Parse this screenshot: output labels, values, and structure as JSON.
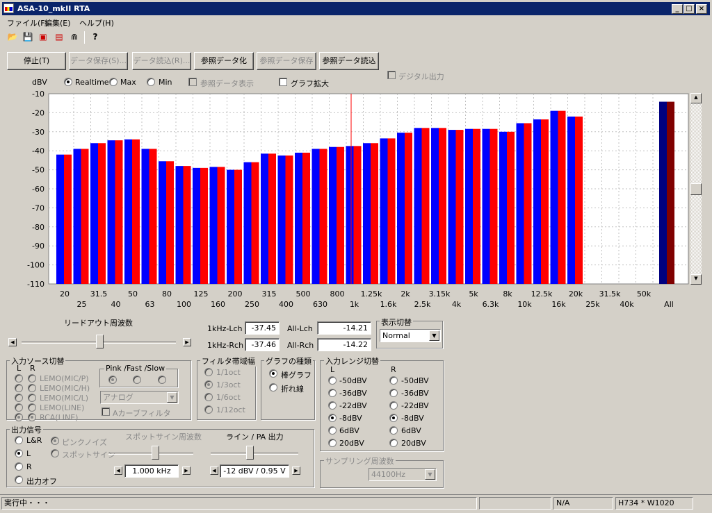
{
  "window": {
    "title": "ASA-10_mkII RTA",
    "min": "_",
    "max": "□",
    "close": "×"
  },
  "menu": [
    "ファイル(F)",
    "編集(E)",
    "ヘルプ(H)"
  ],
  "toolbar_icons": [
    "open-icon",
    "save-icon",
    "save-as-icon",
    "export-icon",
    "connect-icon",
    "help-icon"
  ],
  "buttons": {
    "stop": "停止(T)",
    "save_data": "データ保存(S)...",
    "load_data": "データ読込(R)...",
    "ref_set": "参照データ化",
    "ref_save": "参照データ保存",
    "ref_load": "参照データ読込"
  },
  "display": {
    "unit": "dBV",
    "realtime": "Realtime",
    "max": "Max",
    "min": "Min",
    "ref_show": "参照データ表示",
    "zoom": "グラフ拡大",
    "digital_out": "デジタル出力"
  },
  "chart_data": {
    "type": "bar",
    "ylim": [
      -110,
      -10
    ],
    "yticks": [
      "-10",
      "-20",
      "-30",
      "-40",
      "-50",
      "-60",
      "-70",
      "-80",
      "-90",
      "-100",
      "-110"
    ],
    "categories": [
      "20",
      "25",
      "31.5",
      "40",
      "50",
      "63",
      "80",
      "100",
      "125",
      "160",
      "200",
      "250",
      "315",
      "400",
      "500",
      "630",
      "800",
      "1k",
      "1.25k",
      "1.6k",
      "2k",
      "2.5k",
      "3.15k",
      "4k",
      "5k",
      "6.3k",
      "8k",
      "10k",
      "12.5k",
      "16k",
      "20k",
      "25k",
      "31.5k",
      "40k",
      "50k",
      "All"
    ],
    "series": [
      {
        "values": [
          -42,
          -39,
          -36,
          -34.5,
          -34,
          -39,
          -45.5,
          -48,
          -49,
          -48.5,
          -50,
          -46,
          -41.5,
          -42.5,
          -41,
          -39,
          -38,
          -37.5,
          -36,
          -33.5,
          -30.5,
          -28,
          -28,
          -29,
          -28.5,
          -28.5,
          -30,
          -25.5,
          -23.5,
          -19,
          -22,
          null,
          null,
          null,
          null,
          -14.21
        ],
        "color": "#0000ff",
        "all_color": "#000080"
      },
      {
        "values": [
          -42,
          -39,
          -36,
          -34.5,
          -34,
          -39,
          -45.5,
          -48,
          -49,
          -48.5,
          -50,
          -46,
          -41.5,
          -42.5,
          -41,
          -39,
          -38,
          -37.5,
          -36,
          -33.5,
          -30.5,
          -28,
          -28,
          -29,
          -28.5,
          -28.5,
          -30,
          -25.5,
          -23.5,
          -19,
          -22,
          null,
          null,
          null,
          null,
          -14.22
        ],
        "color": "#ff0000",
        "all_color": "#800000"
      }
    ]
  },
  "readout": {
    "lch_label": "1kHz-Lch",
    "lch": "-37.45",
    "rch_label": "1kHz-Rch",
    "rch": "-37.46",
    "all_l_label": "All-Lch",
    "all_l": "-14.21",
    "all_r_label": "All-Rch",
    "all_r": "-14.22"
  },
  "readout_freq": {
    "label": "リードアウト周波数"
  },
  "view_switch": {
    "title": "表示切替",
    "value": "Normal"
  },
  "input_source": {
    "title": "入力ソース切替",
    "l": "L",
    "r": "R",
    "items": [
      "LEMO(MIC/P)",
      "LEMO(MIC/H)",
      "LEMO(MIC/L)",
      "LEMO(LINE)",
      "RCA(LINE)"
    ],
    "pink_title": "Pink /Fast /Slow",
    "analog": "アナログ",
    "acurve": "Aカーブフィルタ"
  },
  "filter_bw": {
    "title": "フィルタ帯域幅",
    "items": [
      "1/1oct",
      "1/3oct",
      "1/6oct",
      "1/12oct"
    ]
  },
  "graph_type": {
    "title": "グラフの種類",
    "items": [
      "棒グラフ",
      "折れ線"
    ]
  },
  "input_range": {
    "title": "入力レンジ切替",
    "l": "L",
    "r": "R",
    "items": [
      "-50dBV",
      "-36dBV",
      "-22dBV",
      "-8dBV",
      "6dBV",
      "20dBV"
    ]
  },
  "output": {
    "title": "出力信号",
    "items": [
      "L&R",
      "L",
      "R",
      "出力オフ"
    ],
    "pink": "ピンクノイズ",
    "spot": "スポットサイン",
    "spot_freq_title": "スポットサイン周波数",
    "spot_freq": "1.000 kHz",
    "line_title": "ライン / PA 出力",
    "line_val": "-12 dBV / 0.95 V"
  },
  "sampling": {
    "title": "サンプリング周波数",
    "value": "44100Hz"
  },
  "status": {
    "running": "実行中・・・",
    "na": "N/A",
    "size": "H734 * W1020"
  }
}
